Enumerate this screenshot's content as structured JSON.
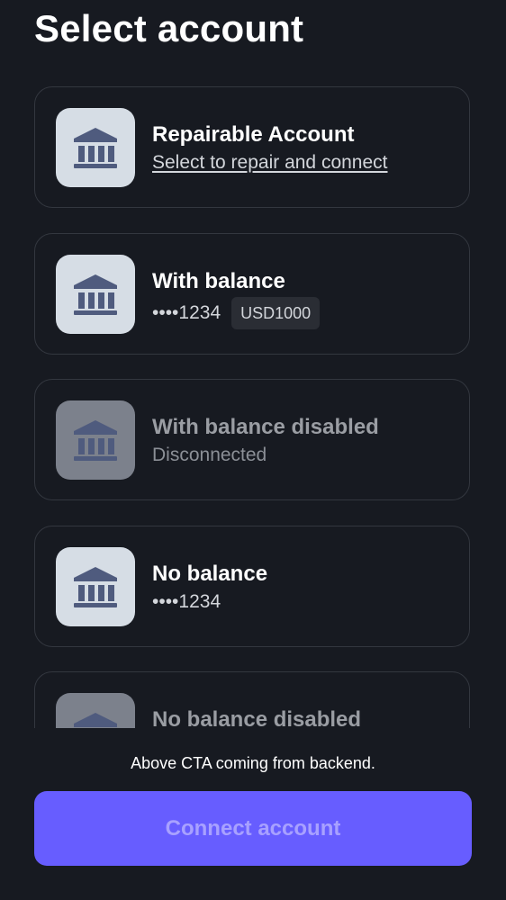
{
  "header": {
    "title": "Select account"
  },
  "accounts": [
    {
      "name": "Repairable Account",
      "subtitle": "Select to repair and connect",
      "icon": "bank-icon",
      "disabled": false
    },
    {
      "name": "With balance",
      "subtitle": "••••1234",
      "balance_badge": "USD1000",
      "icon": "bank-icon",
      "disabled": false
    },
    {
      "name": "With balance disabled",
      "subtitle": "Disconnected",
      "icon": "bank-icon",
      "disabled": true
    },
    {
      "name": "No balance",
      "subtitle": "••••1234",
      "icon": "bank-icon",
      "disabled": false
    },
    {
      "name": "No balance disabled",
      "icon": "bank-icon",
      "disabled": true
    }
  ],
  "footer": {
    "note": "Above CTA coming from backend.",
    "cta_label": "Connect account"
  },
  "colors": {
    "background": "#171a21",
    "card_border": "#33373f",
    "icon_bg": "#d6dde5",
    "icon_bg_disabled": "#7c818c",
    "icon_fg": "#4f5b7e",
    "primary": "#675dff",
    "primary_text_disabled": "#a8a1ff"
  }
}
